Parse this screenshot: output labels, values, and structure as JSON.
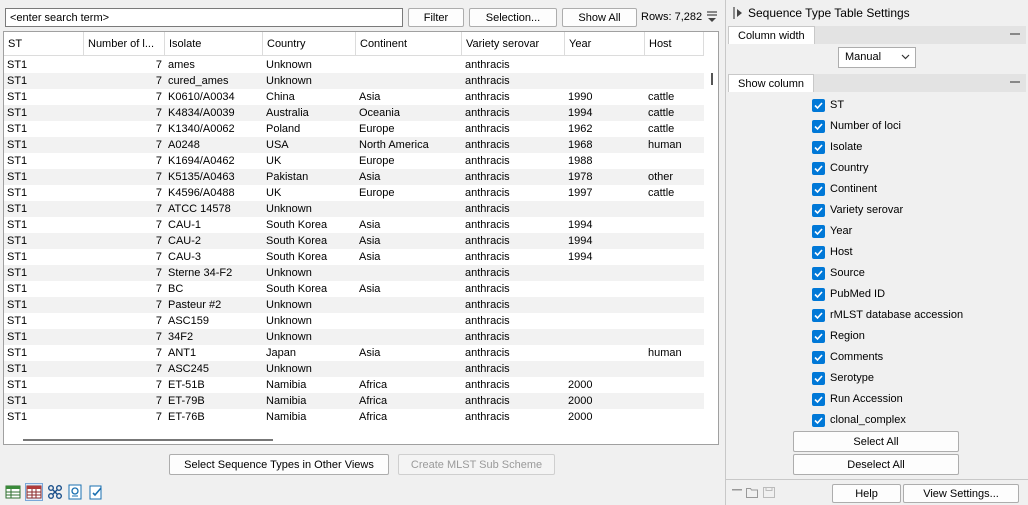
{
  "toolbar": {
    "search_placeholder": "<enter search term>",
    "filter_label": "Filter",
    "selection_label": "Selection...",
    "show_all_label": "Show All",
    "rows_label": "Rows: 7,282"
  },
  "table": {
    "columns": [
      "ST",
      "Number of l...",
      "Isolate",
      "Country",
      "Continent",
      "Variety serovar",
      "Year",
      "Host"
    ],
    "rows": [
      [
        "ST1",
        "7",
        "ames",
        "Unknown",
        "",
        "anthracis",
        "",
        ""
      ],
      [
        "ST1",
        "7",
        "cured_ames",
        "Unknown",
        "",
        "anthracis",
        "",
        ""
      ],
      [
        "ST1",
        "7",
        "K0610/A0034",
        "China",
        "Asia",
        "anthracis",
        "1990",
        "cattle"
      ],
      [
        "ST1",
        "7",
        "K4834/A0039",
        "Australia",
        "Oceania",
        "anthracis",
        "1994",
        "cattle"
      ],
      [
        "ST1",
        "7",
        "K1340/A0062",
        "Poland",
        "Europe",
        "anthracis",
        "1962",
        "cattle"
      ],
      [
        "ST1",
        "7",
        "A0248",
        "USA",
        "North America",
        "anthracis",
        "1968",
        "human"
      ],
      [
        "ST1",
        "7",
        "K1694/A0462",
        "UK",
        "Europe",
        "anthracis",
        "1988",
        ""
      ],
      [
        "ST1",
        "7",
        "K5135/A0463",
        "Pakistan",
        "Asia",
        "anthracis",
        "1978",
        "other"
      ],
      [
        "ST1",
        "7",
        "K4596/A0488",
        "UK",
        "Europe",
        "anthracis",
        "1997",
        "cattle"
      ],
      [
        "ST1",
        "7",
        "ATCC 14578",
        "Unknown",
        "",
        "anthracis",
        "",
        ""
      ],
      [
        "ST1",
        "7",
        "CAU-1",
        "South Korea",
        "Asia",
        "anthracis",
        "1994",
        ""
      ],
      [
        "ST1",
        "7",
        "CAU-2",
        "South Korea",
        "Asia",
        "anthracis",
        "1994",
        ""
      ],
      [
        "ST1",
        "7",
        "CAU-3",
        "South Korea",
        "Asia",
        "anthracis",
        "1994",
        ""
      ],
      [
        "ST1",
        "7",
        "Sterne 34-F2",
        "Unknown",
        "",
        "anthracis",
        "",
        ""
      ],
      [
        "ST1",
        "7",
        "BC",
        "South Korea",
        "Asia",
        "anthracis",
        "",
        ""
      ],
      [
        "ST1",
        "7",
        "Pasteur #2",
        "Unknown",
        "",
        "anthracis",
        "",
        ""
      ],
      [
        "ST1",
        "7",
        "ASC159",
        "Unknown",
        "",
        "anthracis",
        "",
        ""
      ],
      [
        "ST1",
        "7",
        "34F2",
        "Unknown",
        "",
        "anthracis",
        "",
        ""
      ],
      [
        "ST1",
        "7",
        "ANT1",
        "Japan",
        "Asia",
        "anthracis",
        "",
        "human"
      ],
      [
        "ST1",
        "7",
        "ASC245",
        "Unknown",
        "",
        "anthracis",
        "",
        ""
      ],
      [
        "ST1",
        "7",
        "ET-51B",
        "Namibia",
        "Africa",
        "anthracis",
        "2000",
        ""
      ],
      [
        "ST1",
        "7",
        "ET-79B",
        "Namibia",
        "Africa",
        "anthracis",
        "2000",
        ""
      ],
      [
        "ST1",
        "7",
        "ET-76B",
        "Namibia",
        "Africa",
        "anthracis",
        "2000",
        ""
      ]
    ]
  },
  "bottom_actions": {
    "select_in_other_views": "Select Sequence Types in Other Views",
    "create_sub_scheme": "Create MLST Sub Scheme"
  },
  "bottom_icons": [
    "table-view-icon",
    "spreadsheet-icon",
    "tree-icon",
    "report-icon",
    "checklist-icon"
  ],
  "settings": {
    "title": "Sequence Type Table Settings",
    "column_width_tab": "Column width",
    "column_width_value": "Manual",
    "show_column_tab": "Show column",
    "columns": [
      {
        "label": "ST",
        "checked": true
      },
      {
        "label": "Number of loci",
        "checked": true
      },
      {
        "label": "Isolate",
        "checked": true
      },
      {
        "label": "Country",
        "checked": true
      },
      {
        "label": "Continent",
        "checked": true
      },
      {
        "label": "Variety serovar",
        "checked": true
      },
      {
        "label": "Year",
        "checked": true
      },
      {
        "label": "Host",
        "checked": true
      },
      {
        "label": "Source",
        "checked": true
      },
      {
        "label": "PubMed ID",
        "checked": true
      },
      {
        "label": "rMLST database accession",
        "checked": true
      },
      {
        "label": "Region",
        "checked": true
      },
      {
        "label": "Comments",
        "checked": true
      },
      {
        "label": "Serotype",
        "checked": true
      },
      {
        "label": "Run Accession",
        "checked": true
      },
      {
        "label": "clonal_complex",
        "checked": true
      }
    ],
    "select_all_label": "Select All",
    "deselect_all_label": "Deselect All",
    "help_label": "Help",
    "view_settings_label": "View Settings..."
  },
  "colors": {
    "checkbox_accent": "#0078d7",
    "alt_row": "#f2f2f2"
  }
}
